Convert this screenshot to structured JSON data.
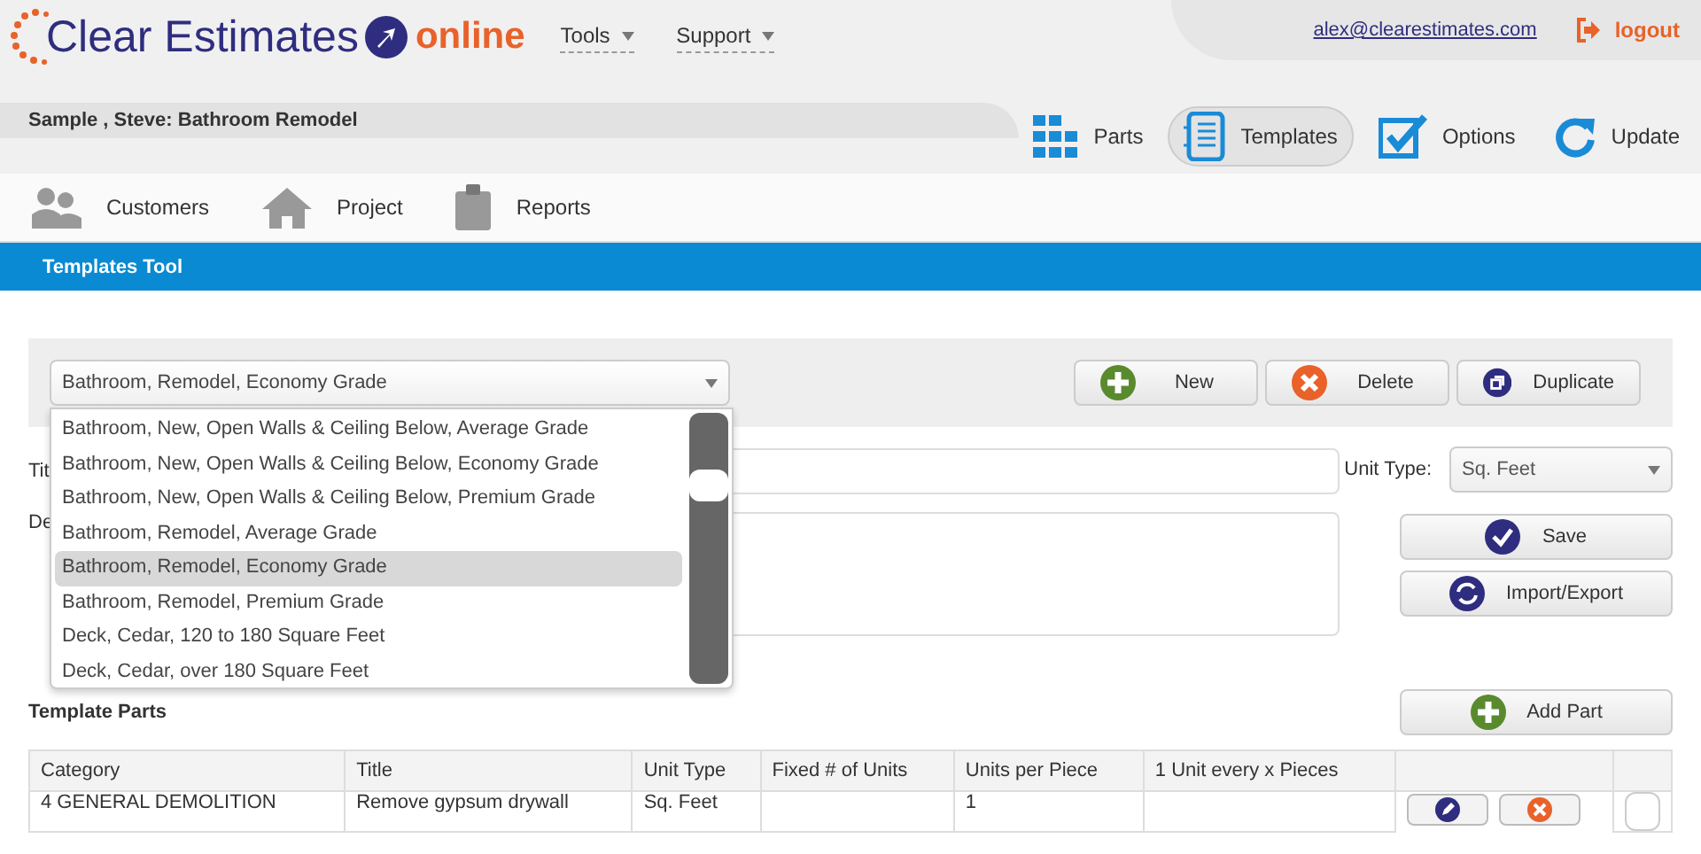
{
  "header": {
    "brand": "Clear Estimates",
    "brand_suffix": "online",
    "menus": [
      {
        "label": "Tools"
      },
      {
        "label": "Support"
      }
    ],
    "user_email": "alex@clearestimates.com",
    "logout": "logout"
  },
  "project_title": "Sample , Steve: Bathroom Remodel",
  "tool_tabs": [
    {
      "label": "Parts",
      "kind": "parts",
      "selected": false
    },
    {
      "label": "Templates",
      "kind": "templates",
      "selected": true
    },
    {
      "label": "Options",
      "kind": "options",
      "selected": false
    },
    {
      "label": "Update",
      "kind": "update",
      "selected": false
    }
  ],
  "nav": [
    {
      "label": "Customers",
      "kind": "customers"
    },
    {
      "label": "Project",
      "kind": "project"
    },
    {
      "label": "Reports",
      "kind": "reports"
    }
  ],
  "section_title": "Templates Tool",
  "template_select": {
    "value": "Bathroom, Remodel, Economy Grade",
    "options": [
      {
        "label": "Bathroom, New, Open Walls & Ceiling Below, Average Grade",
        "selected": false
      },
      {
        "label": "Bathroom, New, Open Walls & Ceiling Below, Economy Grade",
        "selected": false
      },
      {
        "label": "Bathroom, New, Open Walls & Ceiling Below, Premium Grade",
        "selected": false
      },
      {
        "label": "Bathroom, Remodel, Average Grade",
        "selected": false
      },
      {
        "label": "Bathroom, Remodel, Economy Grade",
        "selected": true
      },
      {
        "label": "Bathroom, Remodel, Premium Grade",
        "selected": false
      },
      {
        "label": "Deck, Cedar, 120 to 180 Square Feet",
        "selected": false
      },
      {
        "label": "Deck, Cedar, over 180 Square Feet",
        "selected": false
      }
    ]
  },
  "toolbar_buttons": [
    {
      "label": "New",
      "kind": "add"
    },
    {
      "label": "Delete",
      "kind": "delete"
    },
    {
      "label": "Duplicate",
      "kind": "duplicate"
    }
  ],
  "form": {
    "title_label": "Tit",
    "description_label": "De",
    "unit_type_label": "Unit Type:",
    "unit_type_value": "Sq. Feet"
  },
  "side_buttons": [
    {
      "label": "Save",
      "kind": "save"
    },
    {
      "label": "Import/Export",
      "kind": "import"
    }
  ],
  "parts_title": "Template Parts",
  "add_part": {
    "label": "Add Part",
    "kind": "add"
  },
  "table": {
    "columns": [
      "Category",
      "Title",
      "Unit Type",
      "Fixed # of Units",
      "Units per Piece",
      "1 Unit every x Pieces"
    ],
    "rows": [
      {
        "cells": [
          "4 GENERAL DEMOLITION",
          "Remove gypsum drywall",
          "Sq. Feet",
          "",
          "1",
          ""
        ]
      }
    ]
  }
}
